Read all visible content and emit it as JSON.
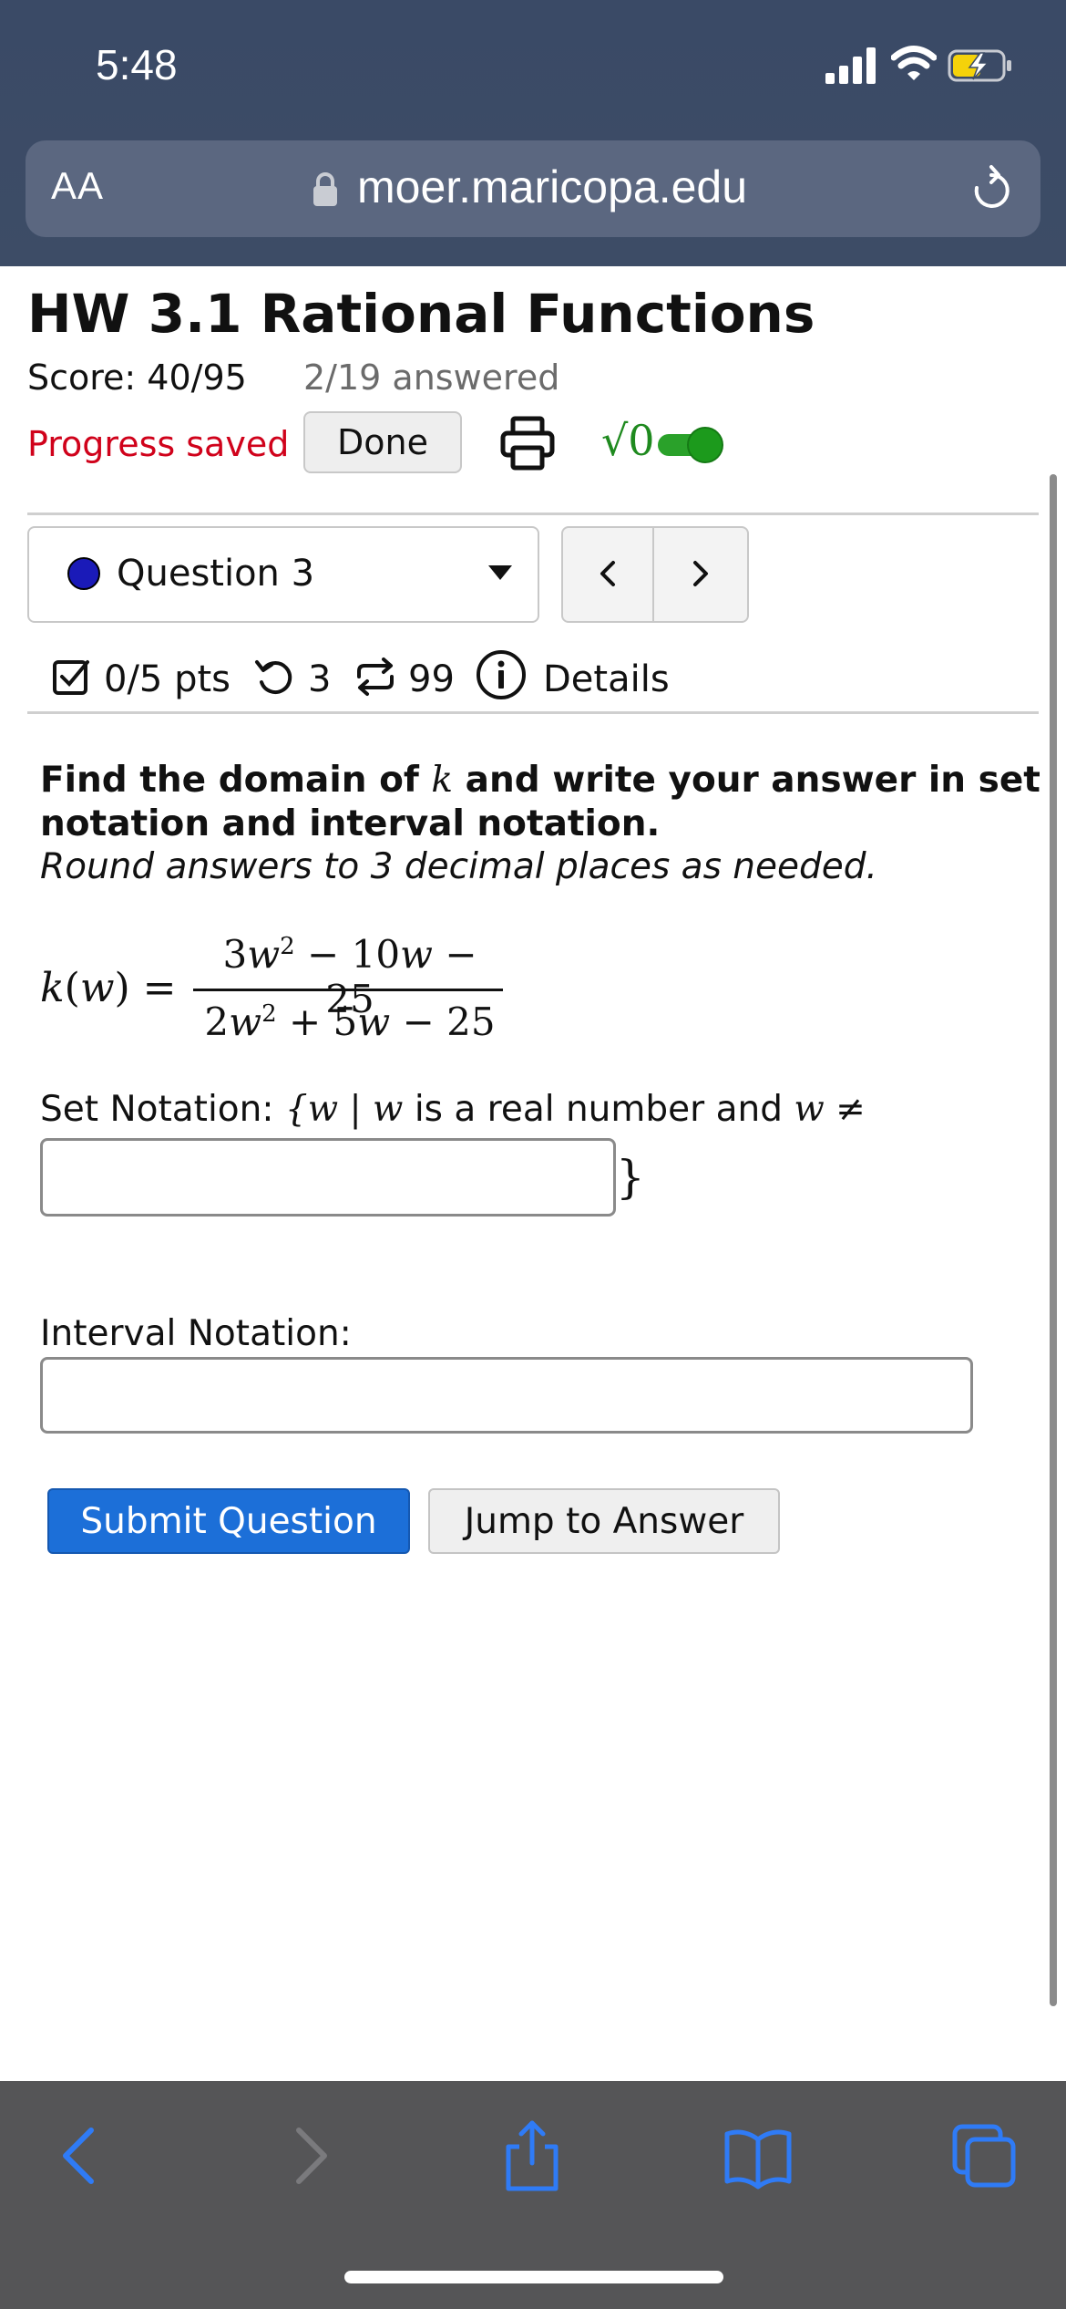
{
  "status_bar": {
    "time": "5:48"
  },
  "address_bar": {
    "text_size_label": "AA",
    "url": "moer.maricopa.edu"
  },
  "page": {
    "title": "HW 3.1 Rational Functions",
    "score": "Score: 40/95",
    "answered": "2/19 answered",
    "progress": "Progress saved",
    "done_label": "Done",
    "math_toggle_label": "√0"
  },
  "question_nav": {
    "selected": "Question 3",
    "prev": "<",
    "next": ">"
  },
  "meta": {
    "points": "0/5 pts",
    "retries": "3",
    "versions": "99",
    "details": "Details"
  },
  "question": {
    "prompt_before": "Find the domain of ",
    "prompt_var": "k",
    "prompt_after": " and write your answer in set notation and interval notation.",
    "instruction": "Round answers to 3 decimal places as needed.",
    "function_lhs": "k(w) =",
    "numerator": "3w² − 10w − 25",
    "denominator": "2w² + 5w − 25",
    "set_label_prefix": "Set Notation: ",
    "set_math_open": "{w | w",
    "set_label_middle": " is a real number and ",
    "set_math_neq": "w ≠",
    "set_close": "}",
    "set_value": "",
    "interval_label": "Interval Notation:",
    "interval_value": ""
  },
  "buttons": {
    "submit": "Submit Question",
    "jump": "Jump to Answer"
  },
  "colors": {
    "accent": "#1c6fd8",
    "saved_red": "#d0021b",
    "mathquill_green": "#1f8a1f",
    "browser_chrome": "#3d4c66"
  }
}
